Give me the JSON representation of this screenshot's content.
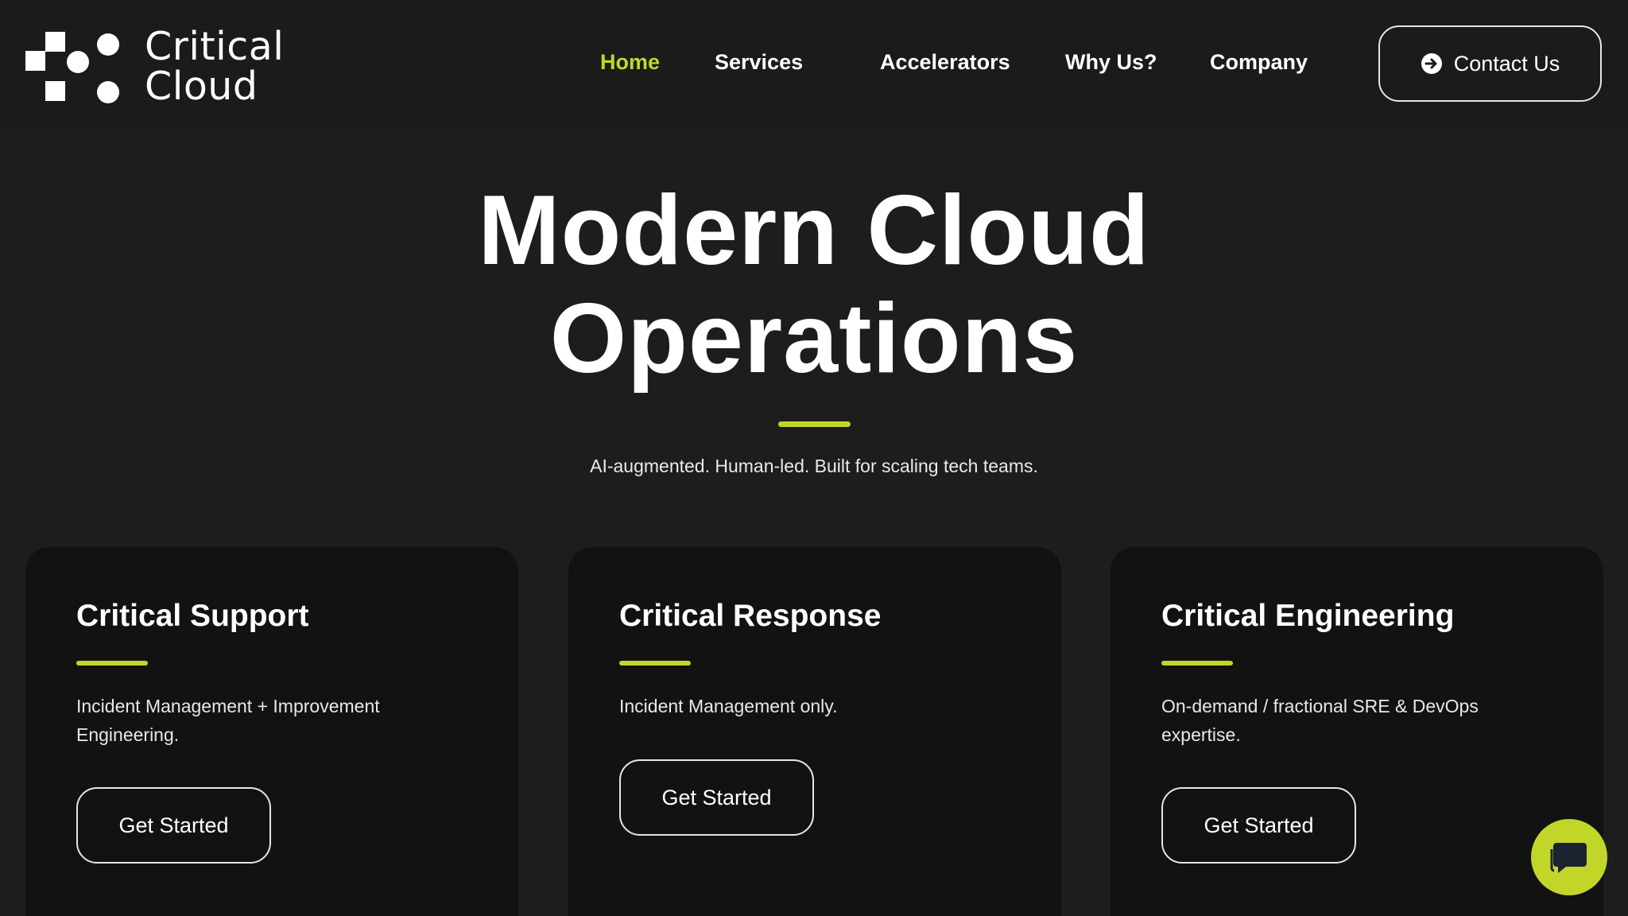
{
  "brand": {
    "line1": "Critical",
    "line2": "Cloud"
  },
  "nav": {
    "items": [
      {
        "label": "Home",
        "active": true
      },
      {
        "label": "Services",
        "active": false
      },
      {
        "label": "Accelerators",
        "active": false
      },
      {
        "label": "Why Us?",
        "active": false
      },
      {
        "label": "Company",
        "active": false
      }
    ],
    "contact_label": "Contact Us",
    "contact_icon": "arrow-circle-right-icon"
  },
  "hero": {
    "title_line1": "Modern Cloud",
    "title_line2": "Operations",
    "subtitle": "AI-augmented. Human-led. Built for scaling tech teams."
  },
  "cards": [
    {
      "title": "Critical Support",
      "description": "Incident Management + Improvement Engineering.",
      "button_label": "Get Started"
    },
    {
      "title": "Critical Response",
      "description": "Incident Management only.",
      "button_label": "Get Started"
    },
    {
      "title": "Critical Engineering",
      "description": "On-demand / fractional SRE & DevOps expertise.",
      "button_label": "Get Started"
    }
  ],
  "chat": {
    "icon": "chat-bubble-icon"
  },
  "colors": {
    "accent": "#c2d62a",
    "background": "#1d1d1d",
    "header_background": "#1b1b1b",
    "card_background": "#121212",
    "text": "#ffffff"
  }
}
